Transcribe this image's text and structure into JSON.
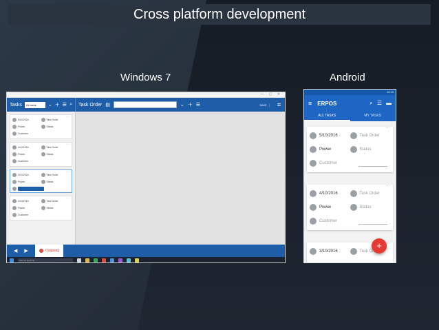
{
  "slide": {
    "title": "Cross platform development",
    "windows_label": "Windows 7",
    "android_label": "Android"
  },
  "windows_app": {
    "toolbar": {
      "tasks_label": "Tasks",
      "filter_value": "All tasks",
      "task_order_label": "Task Order",
      "save_label": "SAVE"
    },
    "cards": [
      {
        "date": "5/10/2016",
        "order": "Task Order",
        "name": "Pwww",
        "status": "Status",
        "customer": "Customer",
        "selected": false
      },
      {
        "date": "4/10/2016",
        "order": "Task Order",
        "name": "Pwww",
        "status": "Status",
        "customer": "Customer",
        "selected": false
      },
      {
        "date": "3/10/2016",
        "order": "Task Order",
        "name": "Pwww",
        "status": "Status",
        "customer": "",
        "selected": true
      },
      {
        "date": "2/10/2016",
        "order": "Task Order",
        "name": "Pwww",
        "status": "Status",
        "customer": "Customer",
        "selected": false
      }
    ],
    "bottom": {
      "outgoing_label": "Outgoing"
    },
    "taskbar": {
      "search_placeholder": "Ask me anything"
    }
  },
  "android_app": {
    "status_time": "10:10",
    "app_name": "ERPOS",
    "tabs": [
      {
        "label": "ALL TASKS",
        "active": true
      },
      {
        "label": "MY TASKS",
        "active": false
      }
    ],
    "cards": [
      {
        "date": "5/10/2016",
        "order": "Task Order",
        "name": "Pwww",
        "status": "Status",
        "customer": "Customer"
      },
      {
        "date": "4/10/2016",
        "order": "Task Order",
        "name": "Pwww",
        "status": "Status",
        "customer": "Customer"
      },
      {
        "date": "3/10/2016",
        "order": "Task Order"
      }
    ],
    "fab_label": "+"
  }
}
